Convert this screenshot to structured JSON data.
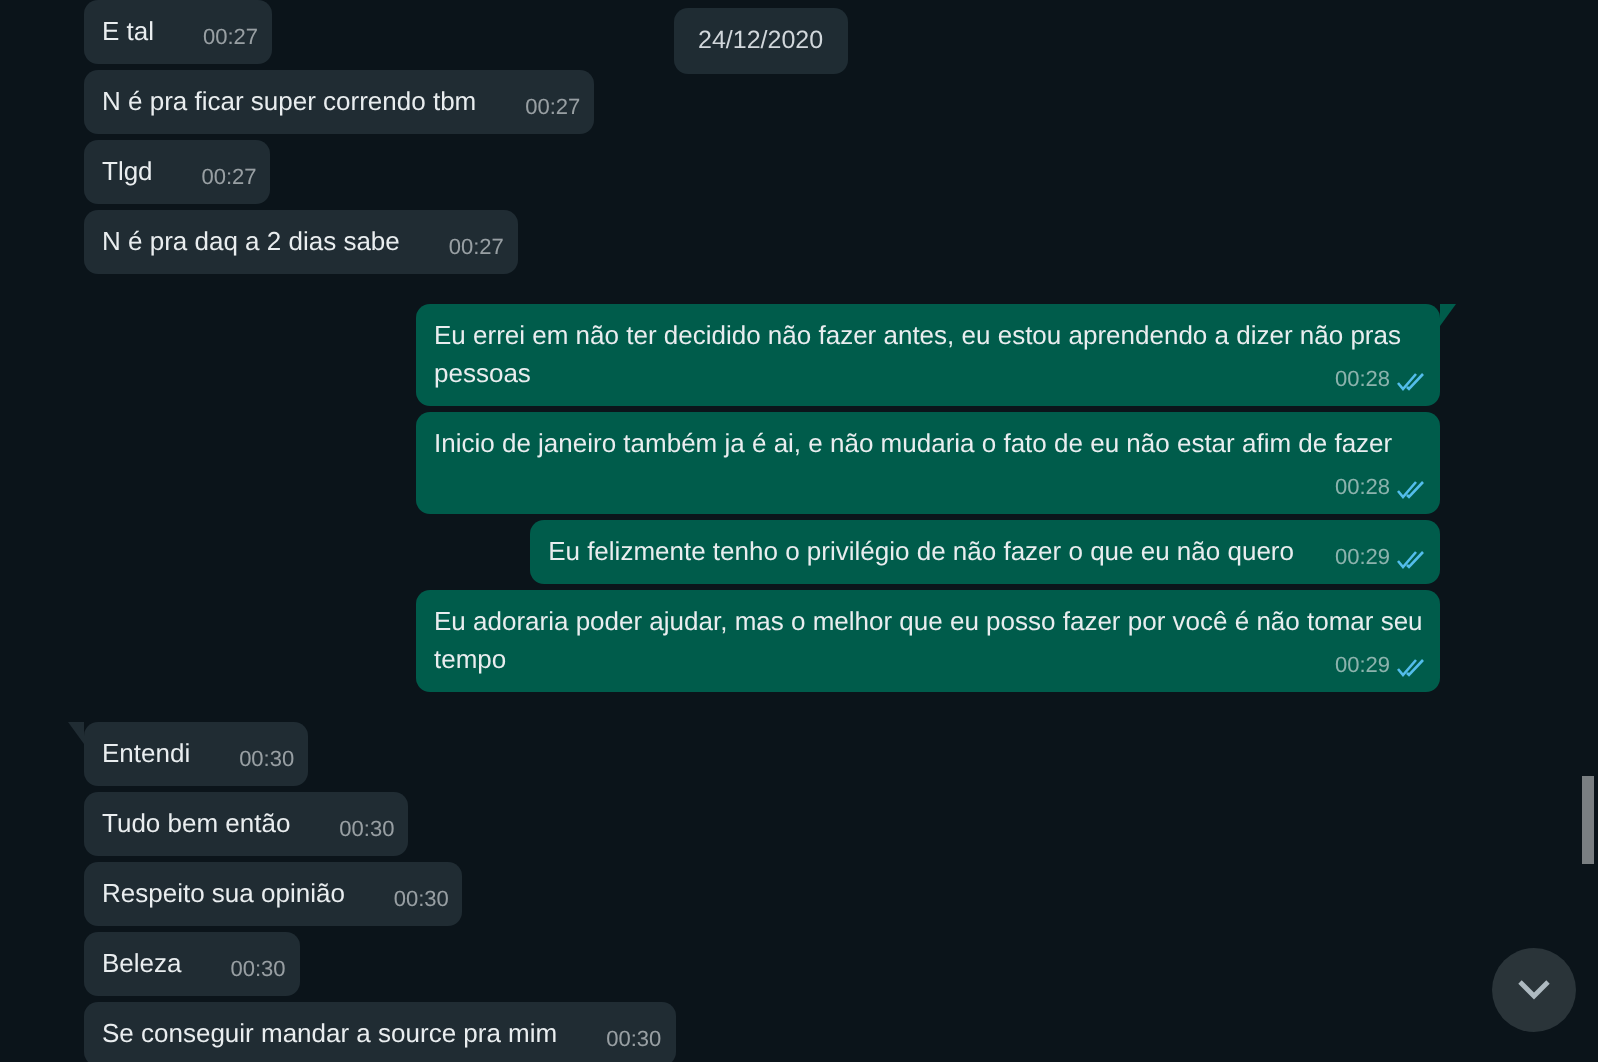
{
  "date_chip": "24/12/2020",
  "messages": [
    {
      "kind": "received",
      "text": "E tal",
      "time": "00:27",
      "tail": false
    },
    {
      "kind": "received",
      "text": "N é pra ficar super correndo tbm",
      "time": "00:27",
      "tail": false
    },
    {
      "kind": "received",
      "text": "Tlgd",
      "time": "00:27",
      "tail": false
    },
    {
      "kind": "received",
      "text": "N é pra daq a 2 dias sabe",
      "time": "00:27",
      "tail": false
    },
    {
      "kind": "sent",
      "text": "Eu errei em não ter decidido não fazer antes, eu estou aprendendo a dizer não pras pessoas",
      "time": "00:28",
      "tail": true,
      "read": true
    },
    {
      "kind": "sent",
      "text": "Inicio de janeiro também ja é ai, e não mudaria o fato de eu não estar afim de fazer",
      "time": "00:28",
      "tail": false,
      "read": true
    },
    {
      "kind": "sent",
      "text": "Eu felizmente tenho o privilégio de não fazer o que eu não quero",
      "time": "00:29",
      "tail": false,
      "read": true
    },
    {
      "kind": "sent",
      "text": "Eu adoraria poder ajudar, mas o melhor que eu posso fazer por você é não tomar seu tempo",
      "time": "00:29",
      "tail": false,
      "read": true
    },
    {
      "kind": "received",
      "text": "Entendi",
      "time": "00:30",
      "tail": true
    },
    {
      "kind": "received",
      "text": "Tudo bem então",
      "time": "00:30",
      "tail": false
    },
    {
      "kind": "received",
      "text": "Respeito sua opinião",
      "time": "00:30",
      "tail": false
    },
    {
      "kind": "received",
      "text": "Beleza",
      "time": "00:30",
      "tail": false
    },
    {
      "kind": "received",
      "text": "Se conseguir mandar a source pra mim",
      "time": "00:30",
      "tail": false
    }
  ]
}
